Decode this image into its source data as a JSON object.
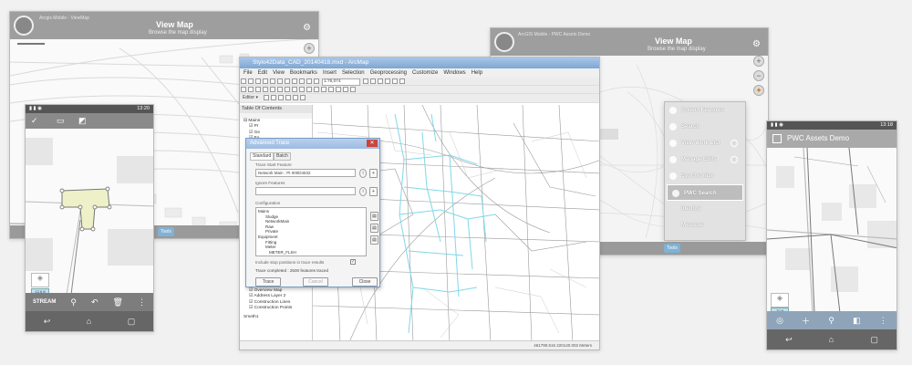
{
  "tablet_left": {
    "app_name": "Arcgis Mobile - ViewMap",
    "title": "View Map",
    "subtitle": "Browse the map display",
    "bottom_button": "Tools"
  },
  "arcmap": {
    "title": "Stylo42Data_CAD_20140418.mxd - ArcMap",
    "menu": [
      "File",
      "Edit",
      "View",
      "Bookmarks",
      "Insert",
      "Selection",
      "Geoprocessing",
      "Customize",
      "Windows",
      "Help"
    ],
    "scale": "1:75,074",
    "toc_title": "Table Of Contents",
    "toc_items": [
      "Mains",
      "Pr",
      "Ge",
      "Fo",
      "Ca",
      "Sa",
      "Pl",
      "Pr",
      "Sa",
      "Mo",
      "Br",
      "Hy",
      "Hy",
      "Fu",
      "Pr",
      "Tr",
      "Sa",
      "Sa",
      "Ma",
      "Ma",
      "Ma",
      "Ma",
      "Ma",
      "Ma",
      "Lo",
      "Co",
      "Sa",
      "Ci",
      "MasterMap",
      "Overview Map",
      "Address Layer 2",
      "Construction Lines",
      "Construction Points"
    ],
    "toc_footer": "Smeth1",
    "status_coords": "461790.515  220140.002 Meters",
    "dialog": {
      "title": "Advanced Trace",
      "tabs": [
        "Standard",
        "Batch"
      ],
      "start_label": "Trace Start Feature",
      "start_value": "Network Main : Pt 000D4632",
      "ignore_label": "Ignore Features",
      "config_label": "Configuration",
      "tree": [
        "Mains",
        "Sludge",
        "NetworkMain",
        "Raw",
        "Private",
        "Equipment",
        "Fitting",
        "Meter",
        "METER_FLSH"
      ],
      "include_label": "Include stop positions in trace results",
      "status": "Trace completed : 2500 features traced",
      "buttons": [
        "Trace",
        "Cancel",
        "Close"
      ]
    }
  },
  "phone_left": {
    "time": "13:20",
    "scale_chip": "12.6 ft",
    "stream_label": "STREAM"
  },
  "tablet_right": {
    "app_name": "ArcGIS Mobile - PWC Assets Demo",
    "title": "View Map",
    "subtitle": "Browse the map display",
    "bottom_button": "Tools",
    "menu": [
      {
        "label": "Collect Features",
        "arrow": false
      },
      {
        "label": "Search",
        "arrow": false
      },
      {
        "label": "View Work List",
        "arrow": true
      },
      {
        "label": "Manage Edits",
        "arrow": true
      },
      {
        "label": "Synchronize",
        "arrow": false
      },
      {
        "label": "PWC Search",
        "arrow": false,
        "selected": true
      },
      {
        "label": "Identify",
        "arrow": false
      },
      {
        "label": "Measure",
        "arrow": false
      }
    ]
  },
  "phone_right": {
    "time": "13:18",
    "app_title": "PWC Assets Demo",
    "scale_chip": "20 ft"
  },
  "colors": {
    "header_gray": "#9e9e9e",
    "trace_cyan": "#7fd8e8",
    "selection_yellow": "#eef0c8",
    "arcmap_blue": "#7ea6d3"
  }
}
